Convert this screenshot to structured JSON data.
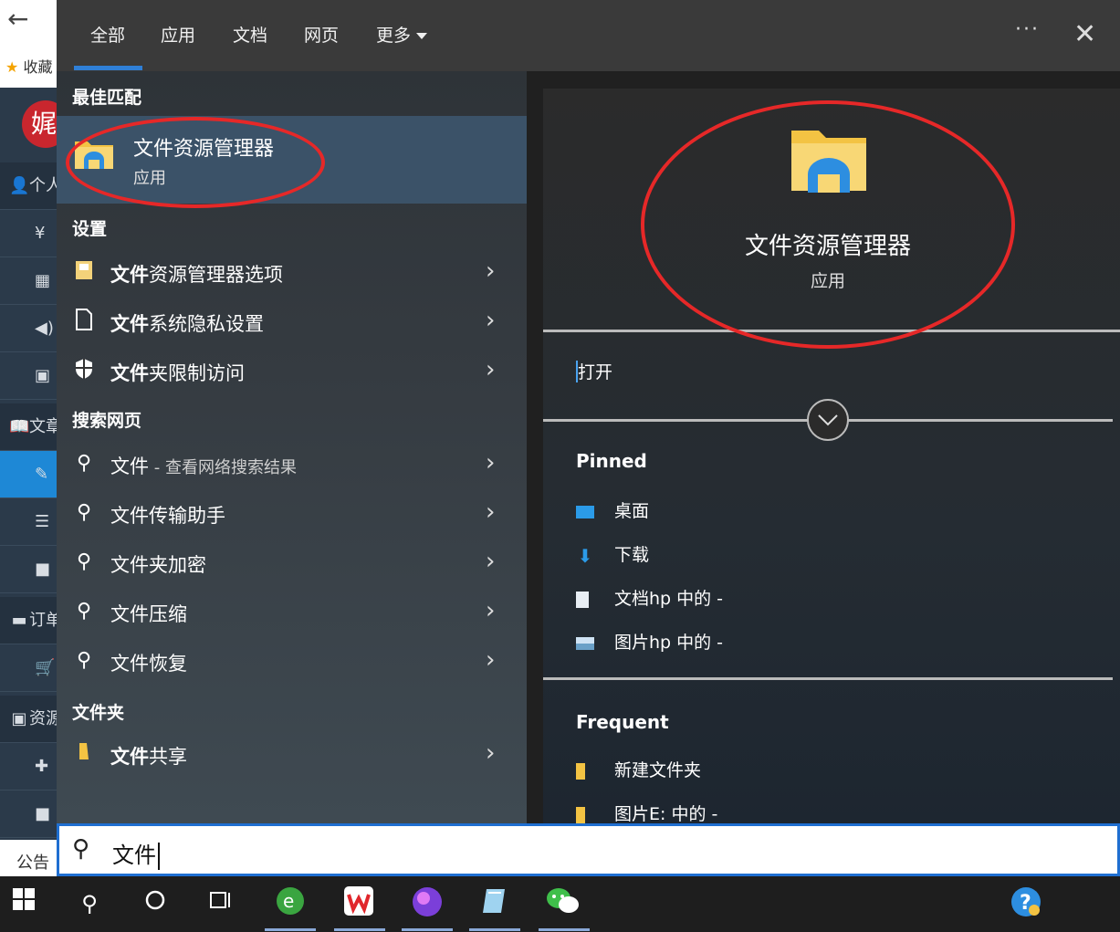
{
  "background_page": {
    "favorites_label": "收藏",
    "logo_char": "娓",
    "sidebar_rows": [
      "个人",
      "¥",
      "",
      "",
      "",
      "文章",
      "",
      "",
      "",
      "订单",
      "",
      "资源",
      "",
      "",
      "公告"
    ]
  },
  "tabs": [
    {
      "label": "全部"
    },
    {
      "label": "应用"
    },
    {
      "label": "文档"
    },
    {
      "label": "网页"
    },
    {
      "label": "更多"
    }
  ],
  "window_controls": {
    "more_label": "···",
    "close_label": "✕"
  },
  "best_match": {
    "section_label": "最佳匹配",
    "title": "文件资源管理器",
    "subtitle": "应用"
  },
  "settings": {
    "section_label": "设置",
    "items": [
      {
        "label_bold": "文件",
        "label_rest": "资源管理器选项"
      },
      {
        "label_bold": "文件",
        "label_rest": "系统隐私设置"
      },
      {
        "label_bold": "文件",
        "label_rest": "夹限制访问"
      }
    ]
  },
  "web_search": {
    "section_label": "搜索网页",
    "items": [
      {
        "label": "文件",
        "hint": " - 查看网络搜索结果"
      },
      {
        "label": "文件传输助手"
      },
      {
        "label": "文件夹加密"
      },
      {
        "label": "文件压缩"
      },
      {
        "label": "文件恢复"
      }
    ]
  },
  "folders": {
    "section_label": "文件夹",
    "items": [
      {
        "label_bold": "文件",
        "label_rest": "共享"
      }
    ]
  },
  "preview": {
    "title": "文件资源管理器",
    "subtitle": "应用",
    "open_label": "打开",
    "pinned": {
      "heading": "Pinned",
      "items": [
        "桌面",
        "下载",
        "文档hp 中的 -",
        "图片hp 中的 -"
      ]
    },
    "frequent": {
      "heading": "Frequent",
      "items": [
        "新建文件夹",
        "图片E: 中的 -"
      ]
    }
  },
  "search": {
    "query": "文件"
  },
  "taskbar": {
    "apps": [
      "windows-start",
      "search",
      "cortana",
      "task-view",
      "360-browser",
      "wps-office",
      "media-app",
      "notepad-app",
      "wechat",
      "help"
    ]
  },
  "colors": {
    "accent": "#2f7fd6",
    "annotation": "#e62828",
    "best_match_bg": "#3b5268"
  }
}
